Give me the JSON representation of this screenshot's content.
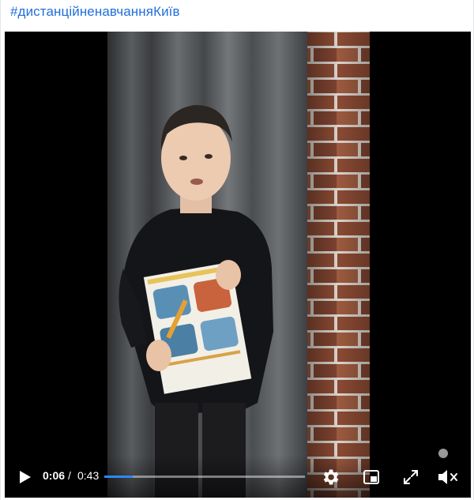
{
  "post": {
    "hashtag": "#дистанційненавчанняКиїв"
  },
  "video": {
    "time_current": "0:06",
    "time_separator": "/",
    "time_total": "0:43",
    "progress_fraction": 0.14,
    "buffered_fraction": 0.14,
    "accent_color": "#2d88ff",
    "controls": {
      "play_icon": "play-icon",
      "settings_icon": "gear-icon",
      "pip_icon": "picture-in-picture-icon",
      "fullscreen_icon": "fullscreen-icon",
      "mute_icon": "speaker-muted-icon"
    }
  }
}
